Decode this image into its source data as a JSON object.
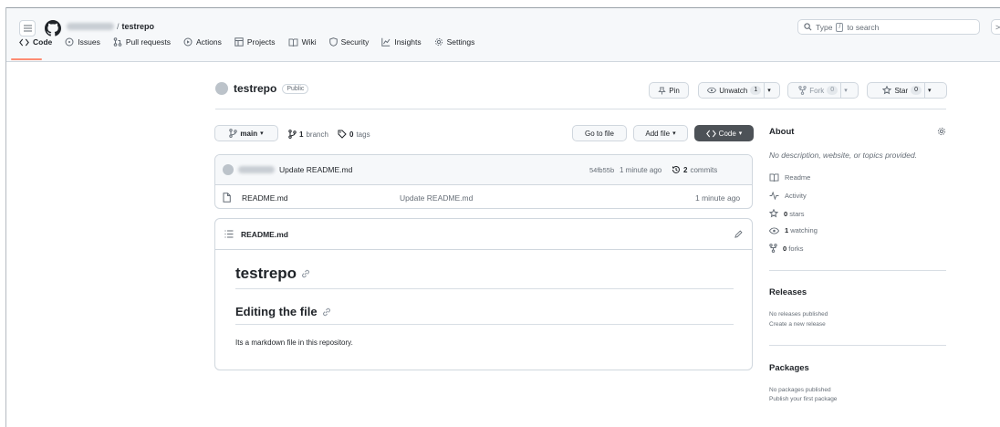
{
  "header": {
    "owner": "anything",
    "slash": "/",
    "repo": "testrepo",
    "search_placeholder_pre": "Type",
    "search_key": "/",
    "search_placeholder_post": "to search",
    "terminal": ">_"
  },
  "tabs": [
    {
      "label": "Code",
      "icon": "code-icon"
    },
    {
      "label": "Issues",
      "icon": "issue-icon"
    },
    {
      "label": "Pull requests",
      "icon": "pull-request-icon"
    },
    {
      "label": "Actions",
      "icon": "play-icon"
    },
    {
      "label": "Projects",
      "icon": "table-icon"
    },
    {
      "label": "Wiki",
      "icon": "book-icon"
    },
    {
      "label": "Security",
      "icon": "shield-icon"
    },
    {
      "label": "Insights",
      "icon": "graph-icon"
    },
    {
      "label": "Settings",
      "icon": "gear-icon"
    }
  ],
  "repo": {
    "name": "testrepo",
    "visibility": "Public",
    "pin": "Pin",
    "unwatch": "Unwatch",
    "watch_count": "1",
    "fork": "Fork",
    "fork_count": "0",
    "star": "Star",
    "star_count": "0"
  },
  "toolbar": {
    "branch": "main",
    "branches_count": "1",
    "branches_label": "branch",
    "tags_count": "0",
    "tags_label": "tags",
    "go_to_file": "Go to file",
    "add_file": "Add file",
    "code": "Code"
  },
  "commit": {
    "author": "anything",
    "message": "Update README.md",
    "hash": "54fb55b",
    "time": "1 minute ago",
    "commits_count": "2",
    "commits_label": "commits"
  },
  "files": [
    {
      "name": "README.md",
      "message": "Update README.md",
      "time": "1 minute ago"
    }
  ],
  "readme": {
    "filename": "README.md",
    "h1": "testrepo",
    "h2": "Editing the file",
    "paragraph": "Its a markdown file in this repository."
  },
  "about": {
    "title": "About",
    "description": "No description, website, or topics provided.",
    "readme": "Readme",
    "activity": "Activity",
    "stars_count": "0",
    "stars_label": "stars",
    "watching_count": "1",
    "watching_label": "watching",
    "forks_count": "0",
    "forks_label": "forks"
  },
  "releases": {
    "title": "Releases",
    "none": "No releases published",
    "create": "Create a new release"
  },
  "packages": {
    "title": "Packages",
    "none": "No packages published",
    "publish": "Publish your first package"
  }
}
